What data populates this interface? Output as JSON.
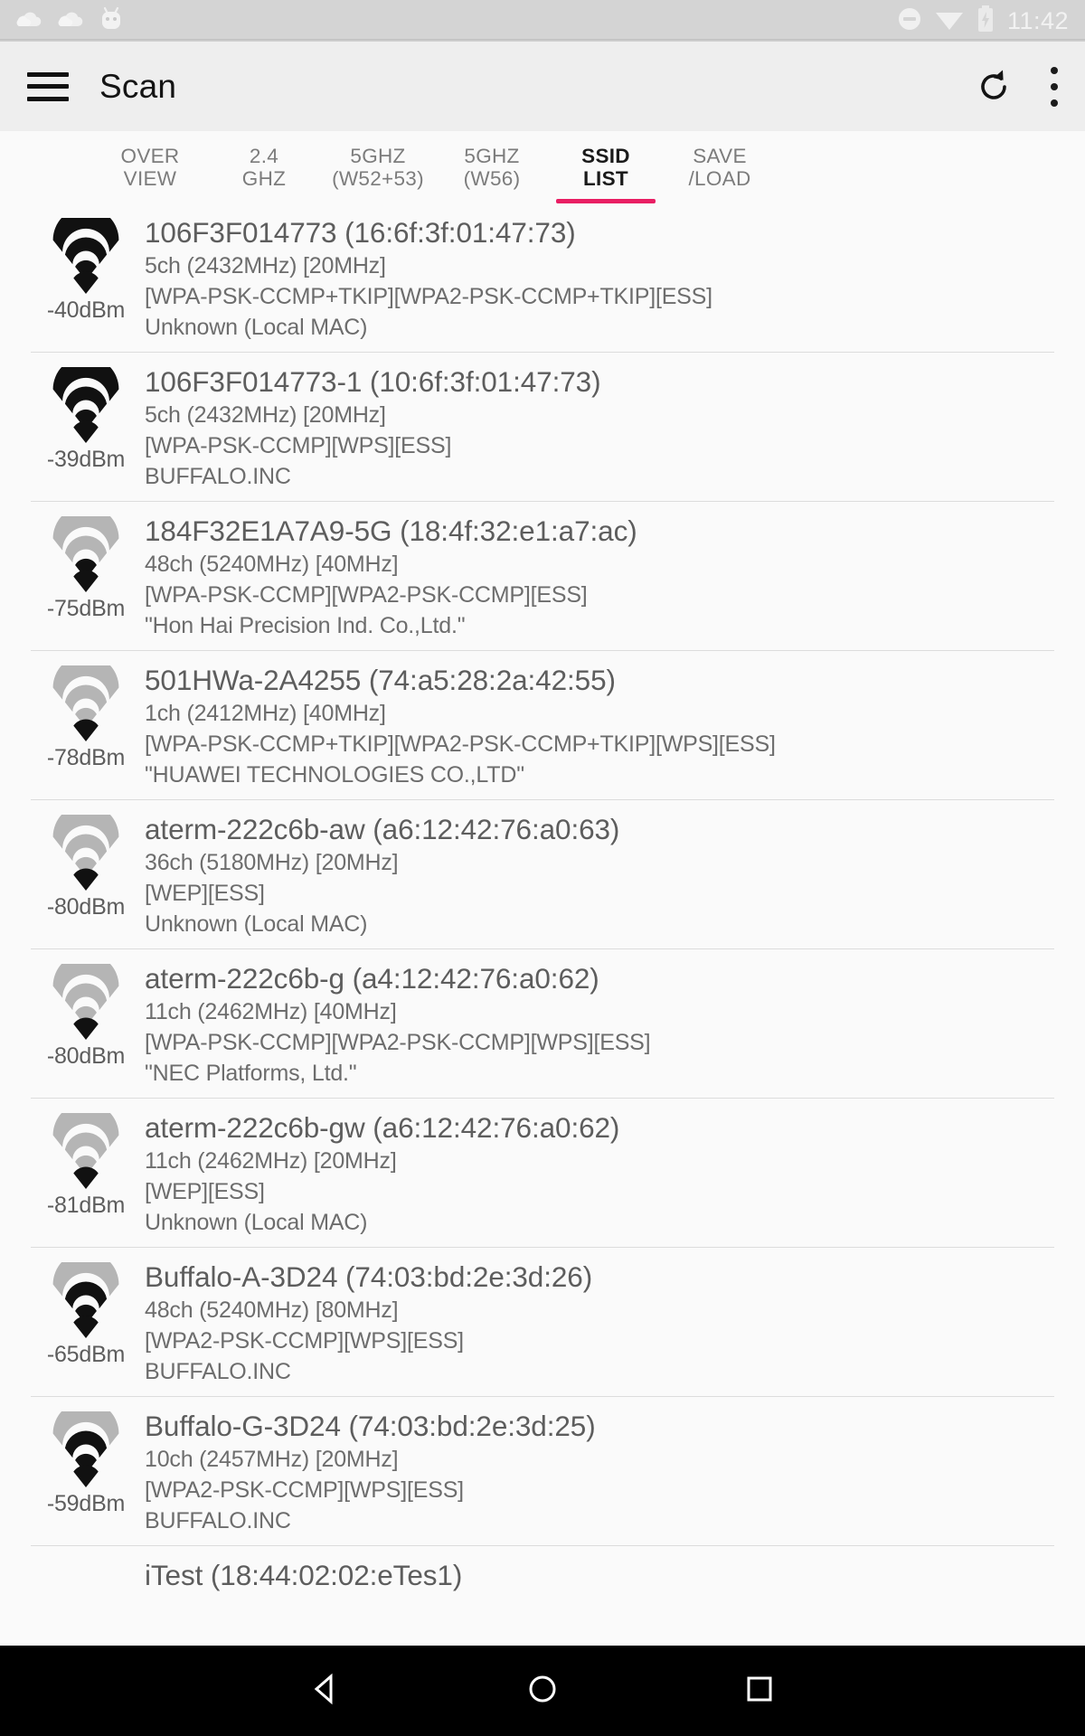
{
  "statusbar": {
    "time": "11:42",
    "icons": [
      "cloud-icon",
      "cloud-icon",
      "android-face-icon",
      "do-not-disturb-icon",
      "wifi-icon",
      "battery-charging-icon"
    ]
  },
  "appbar": {
    "menu_icon": "hamburger-menu-icon",
    "title": "Scan",
    "refresh_icon": "refresh-icon",
    "overflow_icon": "more-vert-icon"
  },
  "tabs": {
    "active_index": 4,
    "items": [
      {
        "line1": "OVER",
        "line2": "VIEW"
      },
      {
        "line1": "2.4",
        "line2": "GHZ"
      },
      {
        "line1": "5GHZ",
        "line2": "(W52+53)"
      },
      {
        "line1": "5GHZ",
        "line2": "(W56)"
      },
      {
        "line1": "SSID",
        "line2": "LIST"
      },
      {
        "line1": "SAVE",
        "line2": "/LOAD"
      }
    ],
    "indicator_color": "#e91e63"
  },
  "networks": [
    {
      "ssid": "106F3F014773 (16:6f:3f:01:47:73)",
      "channel": "5ch (2432MHz) [20MHz]",
      "security": "[WPA-PSK-CCMP+TKIP][WPA2-PSK-CCMP+TKIP][ESS]",
      "vendor": "Unknown (Local MAC)",
      "dbm": "-40dBm",
      "bars": 4
    },
    {
      "ssid": "106F3F014773-1 (10:6f:3f:01:47:73)",
      "channel": "5ch (2432MHz) [20MHz]",
      "security": "[WPA-PSK-CCMP][WPS][ESS]",
      "vendor": "BUFFALO.INC",
      "dbm": "-39dBm",
      "bars": 4
    },
    {
      "ssid": "184F32E1A7A9-5G (18:4f:32:e1:a7:ac)",
      "channel": "48ch (5240MHz) [40MHz]",
      "security": "[WPA-PSK-CCMP][WPA2-PSK-CCMP][ESS]",
      "vendor": "\"Hon Hai Precision Ind. Co.,Ltd.\"",
      "dbm": "-75dBm",
      "bars": 2
    },
    {
      "ssid": "501HWa-2A4255 (74:a5:28:2a:42:55)",
      "channel": "1ch (2412MHz) [40MHz]",
      "security": "[WPA-PSK-CCMP+TKIP][WPA2-PSK-CCMP+TKIP][WPS][ESS]",
      "vendor": "\"HUAWEI TECHNOLOGIES CO.,LTD\"",
      "dbm": "-78dBm",
      "bars": 1
    },
    {
      "ssid": "aterm-222c6b-aw (a6:12:42:76:a0:63)",
      "channel": "36ch (5180MHz) [20MHz]",
      "security": "[WEP][ESS]",
      "vendor": "Unknown (Local MAC)",
      "dbm": "-80dBm",
      "bars": 1
    },
    {
      "ssid": "aterm-222c6b-g (a4:12:42:76:a0:62)",
      "channel": "11ch (2462MHz) [40MHz]",
      "security": "[WPA-PSK-CCMP][WPA2-PSK-CCMP][WPS][ESS]",
      "vendor": "\"NEC Platforms, Ltd.\"",
      "dbm": "-80dBm",
      "bars": 1
    },
    {
      "ssid": "aterm-222c6b-gw (a6:12:42:76:a0:62)",
      "channel": "11ch (2462MHz) [20MHz]",
      "security": "[WEP][ESS]",
      "vendor": "Unknown (Local MAC)",
      "dbm": "-81dBm",
      "bars": 1
    },
    {
      "ssid": "Buffalo-A-3D24 (74:03:bd:2e:3d:26)",
      "channel": "48ch (5240MHz) [80MHz]",
      "security": "[WPA2-PSK-CCMP][WPS][ESS]",
      "vendor": "BUFFALO.INC",
      "dbm": "-65dBm",
      "bars": 3
    },
    {
      "ssid": "Buffalo-G-3D24 (74:03:bd:2e:3d:25)",
      "channel": "10ch (2457MHz) [20MHz]",
      "security": "[WPA2-PSK-CCMP][WPS][ESS]",
      "vendor": "BUFFALO.INC",
      "dbm": "-59dBm",
      "bars": 3
    }
  ],
  "clipped_row": {
    "ssid": "iTest (18:44:02:02:eTes1)"
  },
  "navbar": {
    "back_icon": "back-triangle-icon",
    "home_icon": "home-circle-icon",
    "recents_icon": "recents-square-icon"
  }
}
